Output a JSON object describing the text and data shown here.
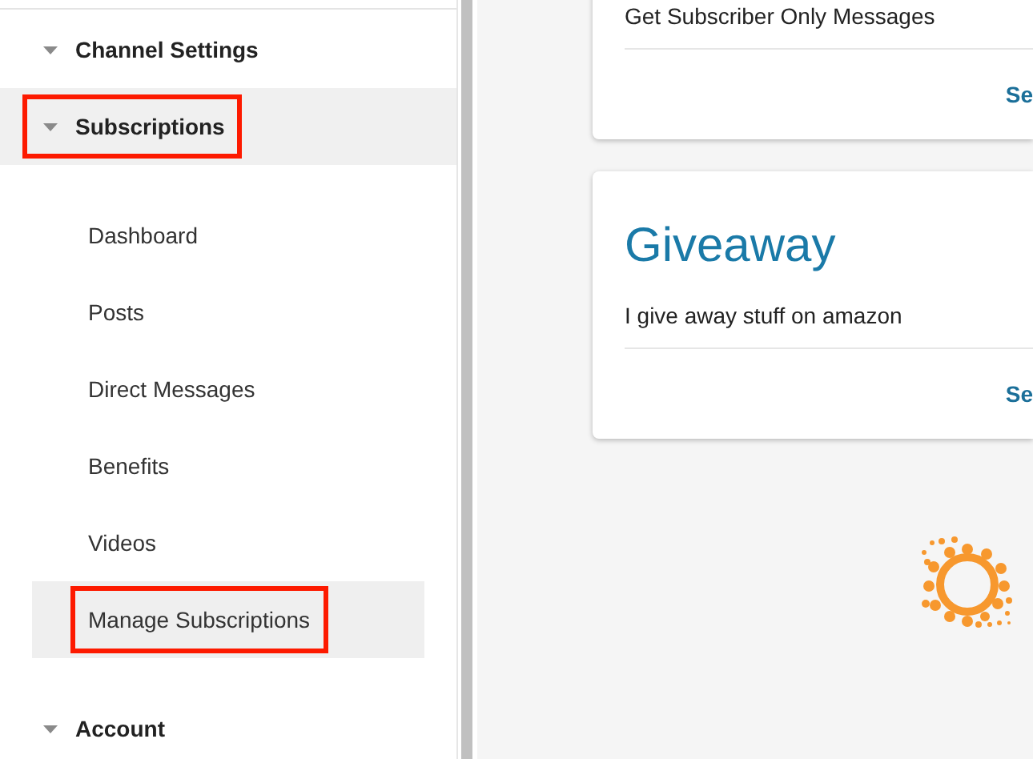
{
  "sidebar": {
    "sections": [
      {
        "label": "Channel Settings",
        "selected": false,
        "highlighted": false
      },
      {
        "label": "Subscriptions",
        "selected": true,
        "highlighted": true,
        "children": [
          {
            "label": "Dashboard",
            "selected": false,
            "highlighted": false
          },
          {
            "label": "Posts",
            "selected": false,
            "highlighted": false
          },
          {
            "label": "Direct Messages",
            "selected": false,
            "highlighted": false
          },
          {
            "label": "Benefits",
            "selected": false,
            "highlighted": false
          },
          {
            "label": "Videos",
            "selected": false,
            "highlighted": false
          },
          {
            "label": "Manage Subscriptions",
            "selected": true,
            "highlighted": true
          }
        ]
      },
      {
        "label": "Account",
        "selected": false,
        "highlighted": false
      }
    ]
  },
  "cards": [
    {
      "description": "Get Subscriber Only Messages",
      "action": "Se"
    },
    {
      "title": "Giveaway",
      "description": "I give away stuff on amazon",
      "action": "Se"
    }
  ]
}
